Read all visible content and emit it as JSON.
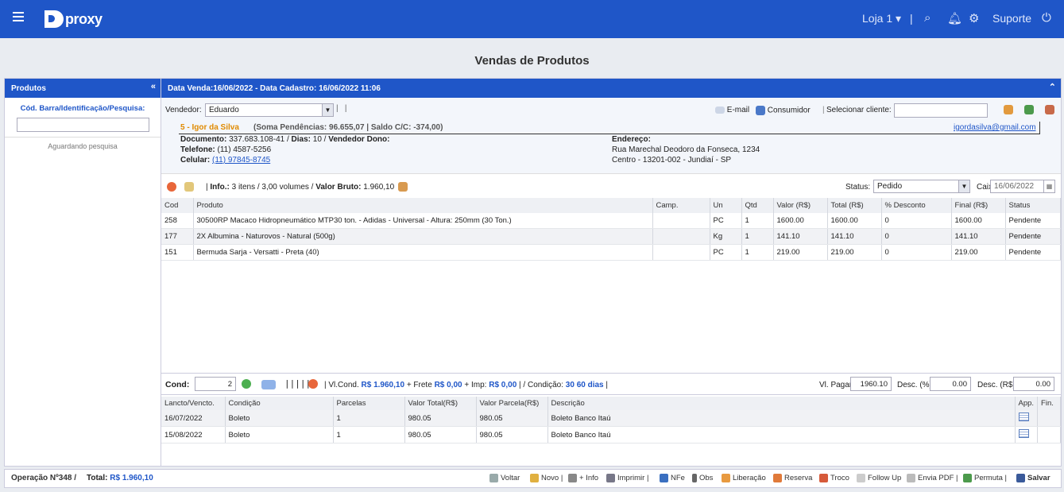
{
  "app": {
    "logo": "proxy",
    "store": "Loja 1",
    "support": "Suporte"
  },
  "page_title": "Vendas de Produtos",
  "left_panel": {
    "title": "Produtos",
    "search_label": "Cód. Barra/Identificação/Pesquisa:",
    "search_value": "",
    "status": "Aguardando pesquisa"
  },
  "header": {
    "text": "Data Venda:16/06/2022 - Data Cadastro: 16/06/2022 11:06"
  },
  "client": {
    "vendedor_label": "Vendedor:",
    "vendedor": "Eduardo",
    "email_label": "E-mail",
    "consumidor_label": "Consumidor",
    "select_label": "Selecionar cliente:",
    "name_line": "5 - Igor da Silva",
    "pend": "(Soma Pendências: 96.655,07 | Saldo C/C: -374,00)",
    "email": "igordasilva@gmail.com",
    "doc_label": "Documento:",
    "doc": "337.683.108-41",
    "dias_label": "Dias:",
    "dias": "10",
    "dono_label": "Vendedor Dono:",
    "tel_label": "Telefone:",
    "tel": "(11) 4587-5256",
    "cel_label": "Celular:",
    "cel": "(11) 97845-8745",
    "end_label": "Endereço:",
    "end1": "Rua Marechal Deodoro da Fonseca, 1234",
    "end2": "Centro - 13201-002 - Jundiaí - SP"
  },
  "info": {
    "label": "Info.:",
    "text": "3 itens / 3,00 volumes /",
    "vb_label": "Valor Bruto:",
    "vb": "1.960,10",
    "status_label": "Status:",
    "status": "Pedido",
    "caixa_label": "Caixa:",
    "caixa": "16/06/2022"
  },
  "items_cols": [
    "Cod",
    "Produto",
    "Camp.",
    "Un",
    "Qtd",
    "Valor (R$)",
    "Total (R$)",
    "% Desconto",
    "Final (R$)",
    "Status"
  ],
  "items": [
    [
      "258",
      "30500RP Macaco Hidropneumático MTP30 ton. - Adidas - Universal - Altura: 250mm (30 Ton.)",
      "",
      "PC",
      "1",
      "1600.00",
      "1600.00",
      "0",
      "1600.00",
      "Pendente"
    ],
    [
      "177",
      "2X Albumina - Naturovos - Natural (500g)",
      "",
      "Kg",
      "1",
      "141.10",
      "141.10",
      "0",
      "141.10",
      "Pendente"
    ],
    [
      "151",
      "Bermuda Sarja - Versatti - Preta (40)",
      "",
      "PC",
      "1",
      "219.00",
      "219.00",
      "0",
      "219.00",
      "Pendente"
    ]
  ],
  "cond": {
    "label": "Cond:",
    "value": "2",
    "vlcond_label": "Vl.Cond.",
    "vlcond": "R$ 1.960,10",
    "frete_label": "+ Frete",
    "frete": "R$ 0,00",
    "imp_label": "+ Imp:",
    "imp": "R$ 0,00",
    "cond_label": "/ Condição:",
    "cond": "30 60 dias",
    "vlpagar_label": "Vl. Pagar:",
    "vlpagar": "1960.10",
    "descp_label": "Desc. (%):",
    "descp": "0.00",
    "descr_label": "Desc. (R$):",
    "descr": "0.00"
  },
  "parc_cols": [
    "Lancto/Vencto.",
    "Condição",
    "Parcelas",
    "Valor Total(R$)",
    "Valor Parcela(R$)",
    "Descrição",
    "App.",
    "Fin."
  ],
  "parcs": [
    [
      "16/07/2022",
      "Boleto",
      "1",
      "980.05",
      "980.05",
      "Boleto Banco Itaú"
    ],
    [
      "15/08/2022",
      "Boleto",
      "1",
      "980.05",
      "980.05",
      "Boleto Banco Itaú"
    ]
  ],
  "footer": {
    "op": "Operação Nº348 /",
    "total_label": "Total:",
    "total": "R$ 1.960,10",
    "buttons": [
      "Voltar",
      "Novo",
      "+ Info",
      "Imprimir",
      "NFe",
      "Obs",
      "Liberação",
      "Reserva",
      "Troco",
      "Follow Up",
      "Envia PDF",
      "Permuta",
      "Salvar"
    ]
  },
  "colors": {
    "brand": "#1f56c8",
    "pending_name": "#e08a00"
  }
}
